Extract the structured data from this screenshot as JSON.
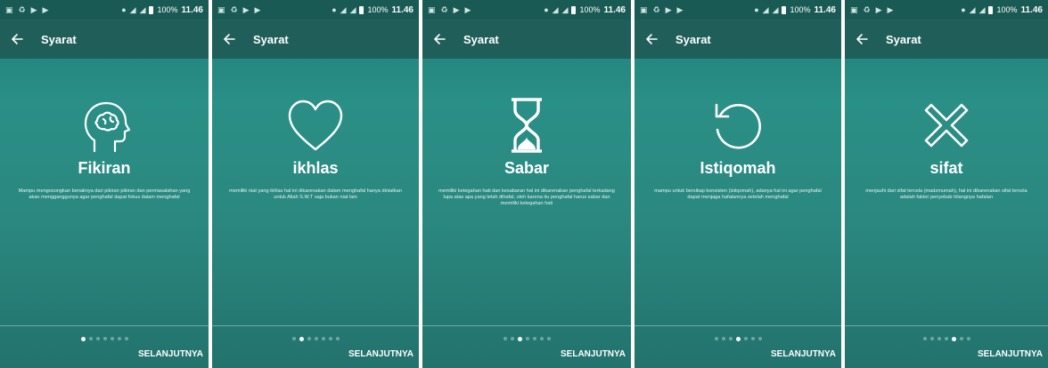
{
  "statusbar": {
    "battery": "100%",
    "time": "11.46"
  },
  "toolbar": {
    "title": "Syarat"
  },
  "footer": {
    "next_label": "SELANJUTNYA",
    "dot_count": 7
  },
  "screens": [
    {
      "icon": "head-brain-icon",
      "title": "Fikiran",
      "description": "Mampu mengosongkan benaknya dari pikiran pikiran dan permasalahan yang akan mengganggunya agar penghafal dapat fokus dalam menghafal",
      "active_dot": 0
    },
    {
      "icon": "heart-icon",
      "title": "ikhlas",
      "description": "memiliki niat yang ikhlas hal ini dikarenakan dalam menghafal hanya diniatkan untuk Allah S.W.T saja bukan niat lain",
      "active_dot": 1
    },
    {
      "icon": "hourglass-icon",
      "title": "Sabar",
      "description": "memiliki ketegahan hati dan kesabaran hal ini dikarenakan penghafal terkadang lupa atas apa yang telah dihafal, oleh karena itu penghafal harus sabar dan memiliki ketegahan hati",
      "active_dot": 2
    },
    {
      "icon": "refresh-icon",
      "title": "Istiqomah",
      "description": "mampu untuk bersikap konsisten (istiqomah), adanya hal ini agar penghafal dapat menjaga hafalannya setelah menghafal",
      "active_dot": 3
    },
    {
      "icon": "cross-icon",
      "title": "sifat",
      "description": "menjauhi dari sifat tercela (madzmumah), hal ini dikarenakan sifat tercela adalah faktor penyebab hilangnya hafalan",
      "active_dot": 4
    }
  ]
}
